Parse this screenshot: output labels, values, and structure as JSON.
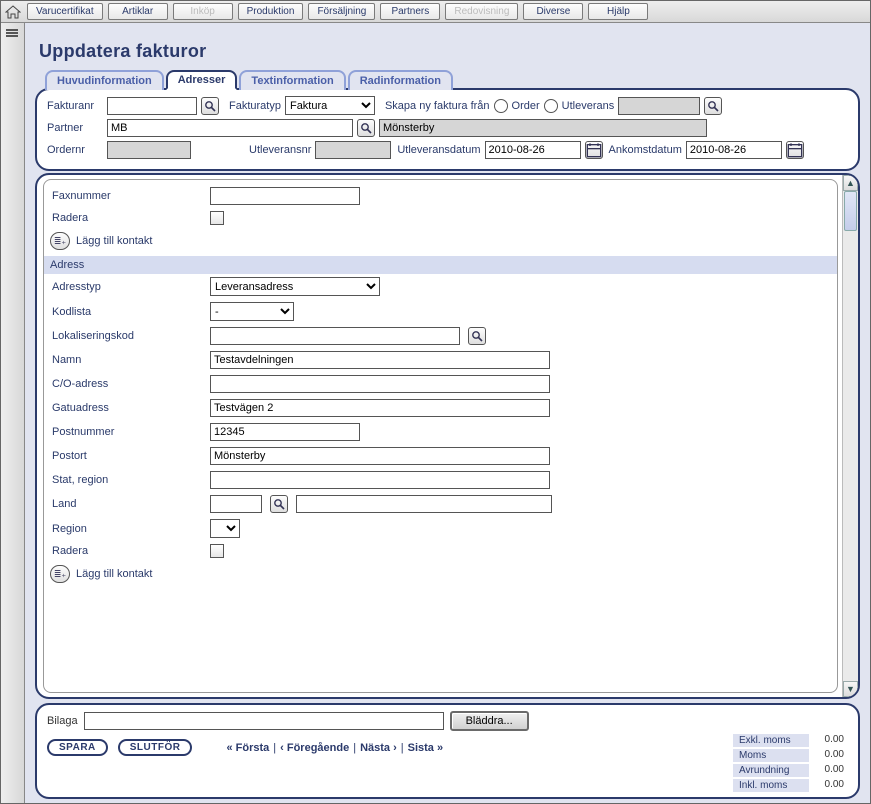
{
  "menu": {
    "items": [
      {
        "label": "Varucertifikat",
        "disabled": false
      },
      {
        "label": "Artiklar",
        "disabled": false
      },
      {
        "label": "Inköp",
        "disabled": true
      },
      {
        "label": "Produktion",
        "disabled": false
      },
      {
        "label": "Försäljning",
        "disabled": false
      },
      {
        "label": "Partners",
        "disabled": false
      },
      {
        "label": "Redovisning",
        "disabled": true
      },
      {
        "label": "Diverse",
        "disabled": false
      },
      {
        "label": "Hjälp",
        "disabled": false
      }
    ]
  },
  "page": {
    "title": "Uppdatera fakturor"
  },
  "tabs": [
    {
      "label": "Huvudinformation",
      "active": false
    },
    {
      "label": "Adresser",
      "active": true
    },
    {
      "label": "Textinformation",
      "active": false
    },
    {
      "label": "Radinformation",
      "active": false
    }
  ],
  "header": {
    "fakturanr_label": "Fakturanr",
    "fakturanr_value": "",
    "fakturatyp_label": "Fakturatyp",
    "fakturatyp_value": "Faktura",
    "skapa_label": "Skapa ny faktura från",
    "order_label": "Order",
    "utleverans_label": "Utleverans",
    "utleverans_value": "",
    "partner_label": "Partner",
    "partner_code": "MB",
    "partner_name": "Mönsterby",
    "ordernr_label": "Ordernr",
    "ordernr_value": "",
    "utleveransnr_label": "Utleveransnr",
    "utleveransnr_value": "",
    "utleveransdatum_label": "Utleveransdatum",
    "utleveransdatum_value": "2010-08-26",
    "ankomstdatum_label": "Ankomstdatum",
    "ankomstdatum_value": "2010-08-26"
  },
  "body": {
    "faxnummer_label": "Faxnummer",
    "faxnummer_value": "",
    "radera_label": "Radera",
    "add_contact": "Lägg till kontakt",
    "section_adress": "Adress",
    "adresstyp_label": "Adresstyp",
    "adresstyp_value": "Leveransadress",
    "kodlista_label": "Kodlista",
    "kodlista_value": "-",
    "lokaliseringskod_label": "Lokaliseringskod",
    "lokaliseringskod_value": "",
    "namn_label": "Namn",
    "namn_value": "Testavdelningen",
    "co_label": "C/O-adress",
    "co_value": "",
    "gatu_label": "Gatuadress",
    "gatu_value": "Testvägen 2",
    "postnr_label": "Postnummer",
    "postnr_value": "12345",
    "postort_label": "Postort",
    "postort_value": "Mönsterby",
    "stat_label": "Stat, region",
    "stat_value": "",
    "land_label": "Land",
    "land_code": "",
    "land_name": "",
    "region_label": "Region",
    "region_value": ""
  },
  "footer": {
    "bilaga_label": "Bilaga",
    "bilaga_value": "",
    "browse_label": "Bläddra...",
    "save_label": "SPARA",
    "finish_label": "SLUTFÖR",
    "first": "« Första",
    "prev": "‹ Föregående",
    "next": "Nästa ›",
    "last": "Sista »",
    "sep": "|",
    "totals": [
      {
        "label": "Exkl. moms",
        "value": "0.00"
      },
      {
        "label": "Moms",
        "value": "0.00"
      },
      {
        "label": "Avrundning",
        "value": "0.00"
      },
      {
        "label": "Inkl. moms",
        "value": "0.00"
      }
    ]
  }
}
